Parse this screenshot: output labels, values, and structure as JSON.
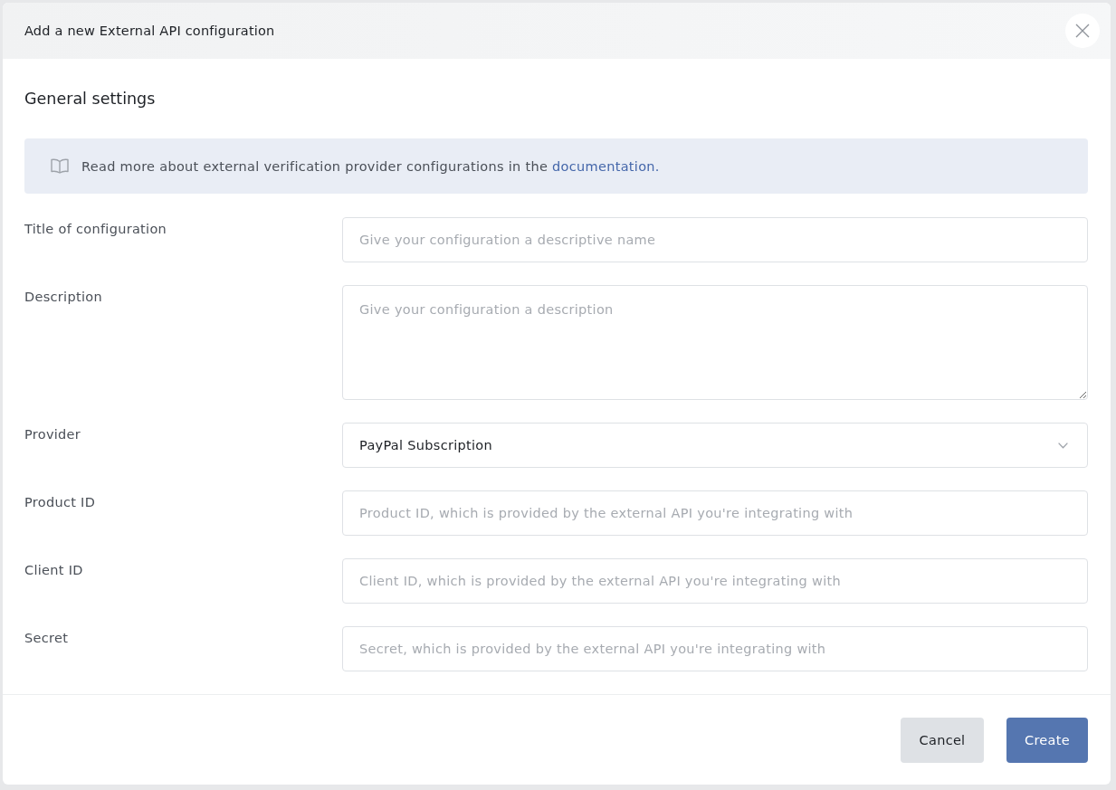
{
  "dialog": {
    "title": "Add a new External API configuration"
  },
  "section": {
    "heading": "General settings"
  },
  "info_banner": {
    "text": "Read more about external verification provider configurations in the",
    "link": "documentation."
  },
  "fields": [
    {
      "kind": "text",
      "label": "Title of configuration",
      "placeholder": "Give your configuration a descriptive name"
    },
    {
      "kind": "textarea",
      "label": "Description",
      "placeholder": "Give your configuration a description"
    },
    {
      "kind": "select",
      "label": "Provider",
      "value": "PayPal Subscription"
    },
    {
      "kind": "text",
      "label": "Product ID",
      "placeholder": "Product ID, which is provided by the external API you're integrating with"
    },
    {
      "kind": "text",
      "label": "Client ID",
      "placeholder": "Client ID, which is provided by the external API you're integrating with"
    },
    {
      "kind": "text",
      "label": "Secret",
      "placeholder": "Secret, which is provided by the external API you're integrating with"
    }
  ],
  "buttons": [
    {
      "kind": "secondary",
      "label": "Cancel"
    },
    {
      "kind": "primary",
      "label": "Create"
    }
  ]
}
